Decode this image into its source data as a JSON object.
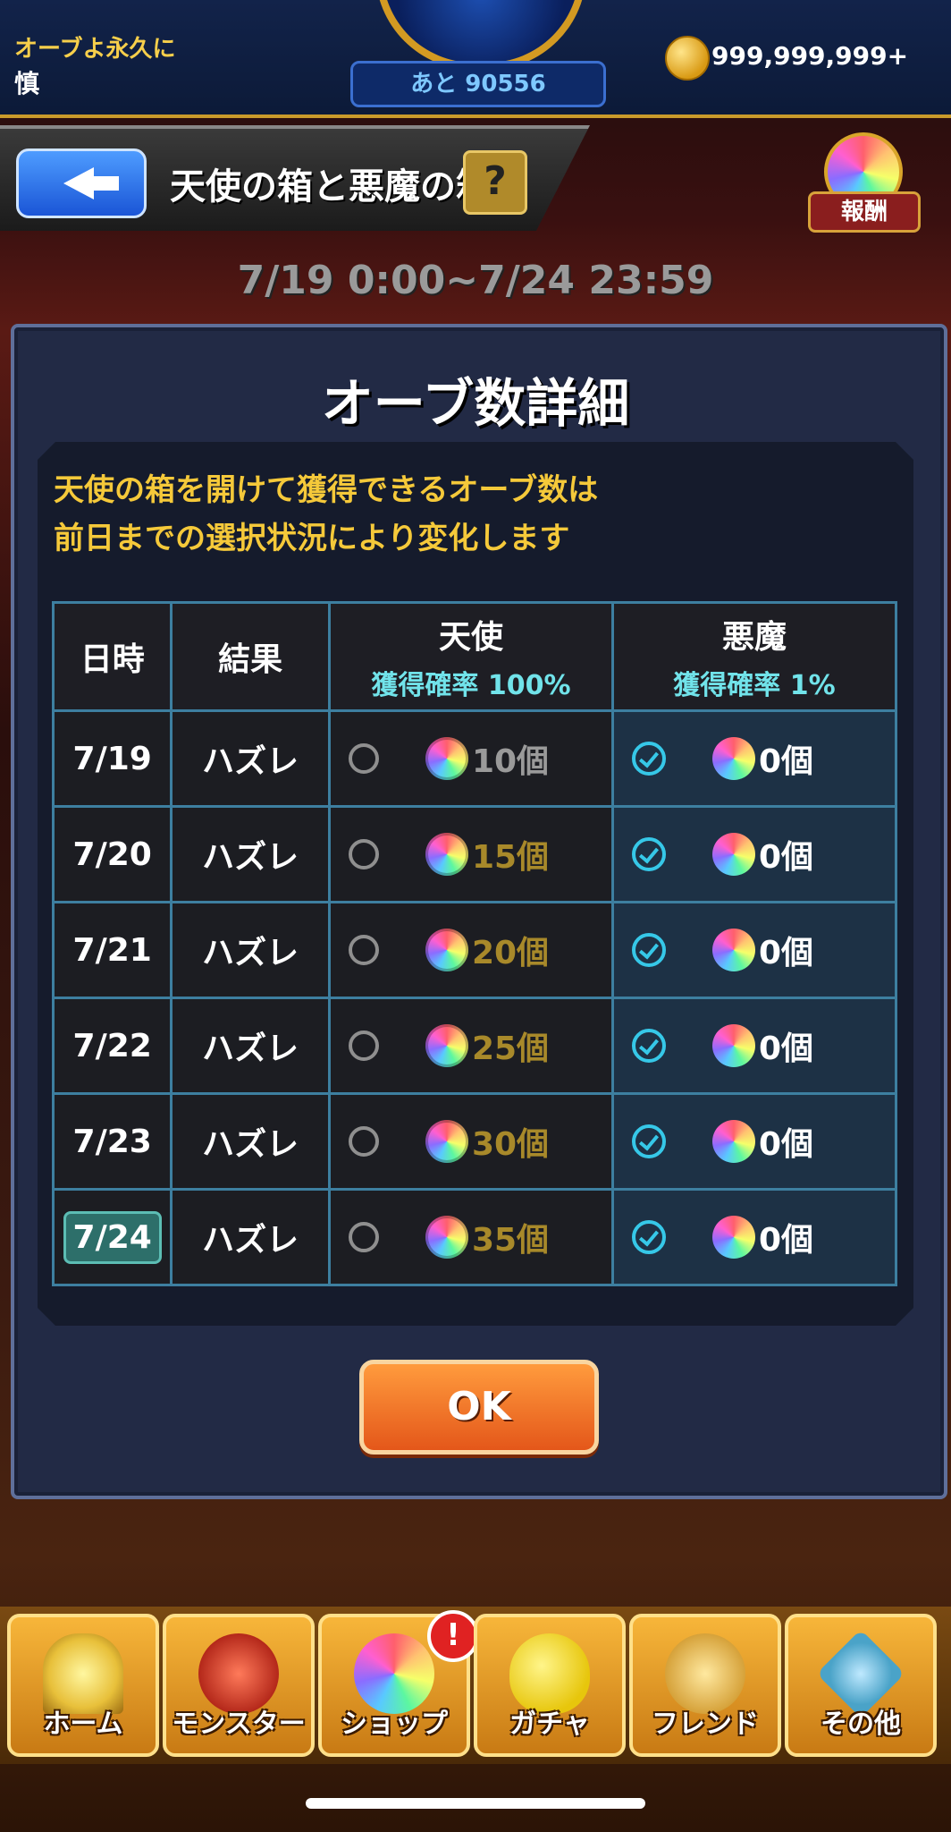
{
  "top_bar": {
    "user_line1": "オーブよ永久に",
    "user_line2": "慎",
    "remaining": "あと 90556",
    "coins": "999,999,999+"
  },
  "header": {
    "title": "天使の箱と悪魔の箱",
    "help_label": "?",
    "reward_label": "報酬",
    "period": "7/19 0:00~7/24 23:59"
  },
  "dialog": {
    "title": "オーブ数詳細",
    "notice_line1": "天使の箱を開けて獲得できるオーブ数は",
    "notice_line2": "前日までの選択状況により変化します",
    "table": {
      "headers": {
        "date": "日時",
        "result": "結果",
        "angel": "天使",
        "angel_rate": "獲得確率 100%",
        "devil": "悪魔",
        "devil_rate": "獲得確率 1%"
      },
      "rows": [
        {
          "date": "7/19",
          "result": "ハズレ",
          "angel_qty": "10個",
          "devil_qty": "0個"
        },
        {
          "date": "7/20",
          "result": "ハズレ",
          "angel_qty": "15個",
          "devil_qty": "0個"
        },
        {
          "date": "7/21",
          "result": "ハズレ",
          "angel_qty": "20個",
          "devil_qty": "0個"
        },
        {
          "date": "7/22",
          "result": "ハズレ",
          "angel_qty": "25個",
          "devil_qty": "0個"
        },
        {
          "date": "7/23",
          "result": "ハズレ",
          "angel_qty": "30個",
          "devil_qty": "0個"
        },
        {
          "date": "7/24",
          "result": "ハズレ",
          "angel_qty": "35個",
          "devil_qty": "0個"
        }
      ]
    },
    "ok_label": "OK"
  },
  "nav": {
    "home": "ホーム",
    "monster": "モンスター",
    "shop": "ショップ",
    "gacha": "ガチャ",
    "friend": "フレンド",
    "other": "その他",
    "shop_alert": "!"
  }
}
